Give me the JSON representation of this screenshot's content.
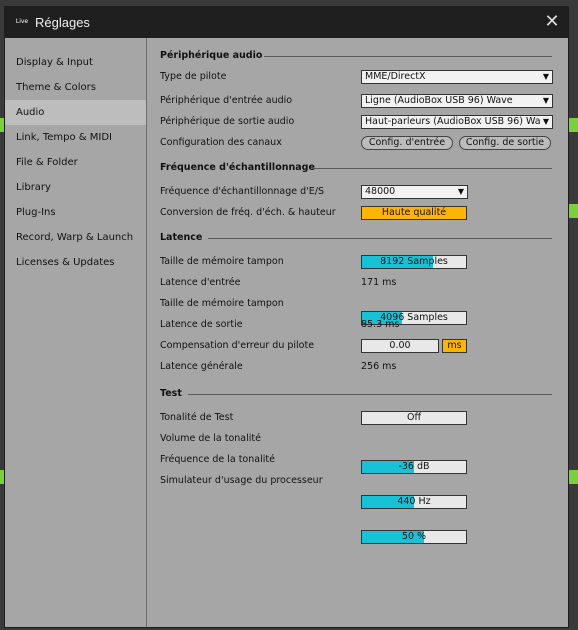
{
  "window": {
    "title": "Réglages",
    "app_logo": "Live",
    "close_icon": "close-icon"
  },
  "sidebar": {
    "items": [
      {
        "label": "Display & Input",
        "active": false
      },
      {
        "label": "Theme & Colors",
        "active": false
      },
      {
        "label": "Audio",
        "active": true
      },
      {
        "label": "Link, Tempo & MIDI",
        "active": false
      },
      {
        "label": "File & Folder",
        "active": false
      },
      {
        "label": "Library",
        "active": false
      },
      {
        "label": "Plug-Ins",
        "active": false
      },
      {
        "label": "Record, Warp & Launch",
        "active": false
      },
      {
        "label": "Licenses & Updates",
        "active": false
      }
    ]
  },
  "audio_device": {
    "heading": "Périphérique audio",
    "driver_type": {
      "label": "Type de pilote",
      "value": "MME/DirectX"
    },
    "input_device": {
      "label": "Périphérique d'entrée audio",
      "value": "Ligne (AudioBox USB 96) Wave"
    },
    "output_device": {
      "label": "Périphérique de sortie audio",
      "value": "Haut-parleurs (AudioBox USB 96) Wave"
    },
    "channel_config": {
      "label": "Configuration des canaux",
      "input_button": "Config. d'entrée",
      "output_button": "Config. de sortie"
    }
  },
  "sample_rate": {
    "heading": "Fréquence d'échantillonnage",
    "io_rate": {
      "label": "Fréquence d'échantillonnage d'E/S",
      "value": "48000"
    },
    "conversion": {
      "label": "Conversion de fréq. d'éch. & hauteur",
      "value": "Haute qualité"
    }
  },
  "latency": {
    "heading": "Latence",
    "buffer_in": {
      "label": "Taille de mémoire tampon",
      "value": "8192 Samples",
      "fraction": 0.68
    },
    "input_latency": {
      "label": "Latence d'entrée",
      "value": "171 ms"
    },
    "buffer_out": {
      "label": "Taille de mémoire tampon",
      "value": "4096 Samples",
      "fraction": 0.38
    },
    "output_latency": {
      "label": "Latence de sortie",
      "value": "85.3 ms"
    },
    "driver_comp": {
      "label": "Compensation d'erreur du pilote",
      "value": "0.00",
      "unit": "ms"
    },
    "overall": {
      "label": "Latence générale",
      "value": "256 ms"
    }
  },
  "test": {
    "heading": "Test",
    "tone": {
      "label": "Tonalité de Test",
      "value": "Off"
    },
    "volume": {
      "label": "Volume de la tonalité",
      "value": "-36 dB",
      "fraction": 0.5
    },
    "frequency": {
      "label": "Fréquence de la tonalité",
      "value": "440 Hz",
      "fraction": 0.5
    },
    "cpu_sim": {
      "label": "Simulateur d'usage du processeur",
      "value": "50 %",
      "fraction": 0.6
    }
  },
  "colors": {
    "accent_cyan": "#17c2d6",
    "accent_orange": "#ffb400",
    "window_bg": "#a6a6a6",
    "titlebar_bg": "#1f1f1f"
  }
}
